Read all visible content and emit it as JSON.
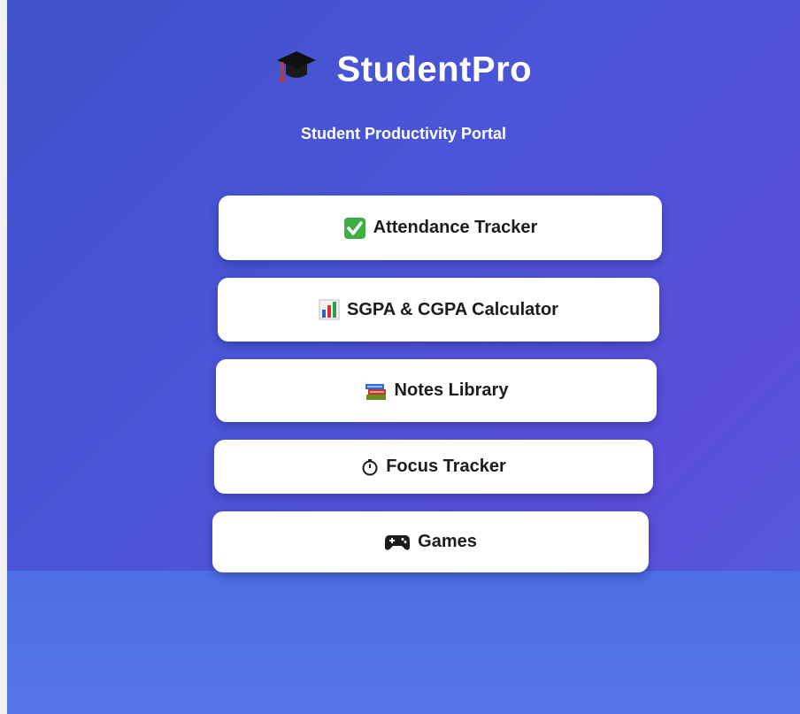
{
  "app": {
    "title": "StudentPro",
    "subtitle": "Student Productivity Portal",
    "logo_icon": "graduation-cap-icon"
  },
  "menu": [
    {
      "label": "Attendance Tracker",
      "icon": "check-mark-icon"
    },
    {
      "label": "SGPA & CGPA Calculator",
      "icon": "bar-chart-icon"
    },
    {
      "label": "Notes Library",
      "icon": "books-icon"
    },
    {
      "label": "Focus Tracker",
      "icon": "stopwatch-icon"
    },
    {
      "label": "Games",
      "icon": "game-controller-icon"
    }
  ],
  "colors": {
    "background": "#4b55d8",
    "button": "#ffffff",
    "text_on_bg": "#ffffff",
    "button_text": "#1c1c1c"
  }
}
